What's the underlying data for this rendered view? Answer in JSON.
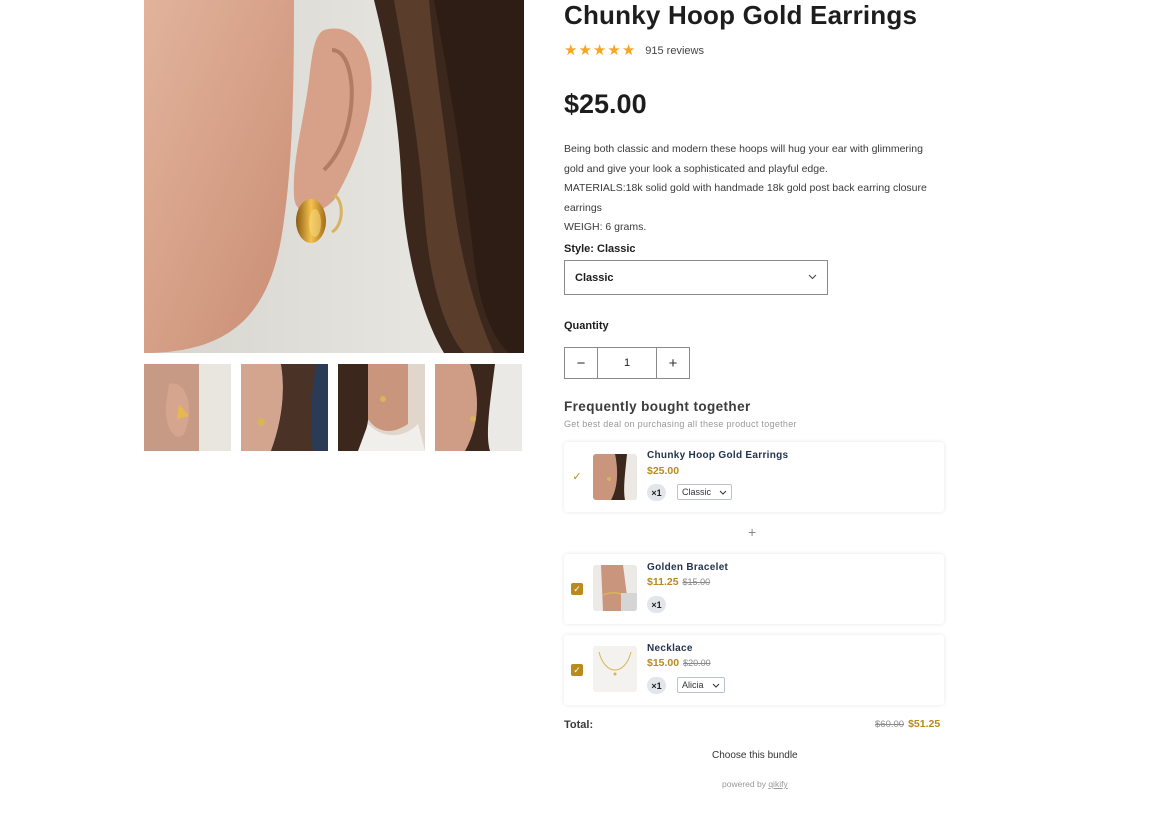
{
  "product": {
    "title": "Chunky Hoop Gold Earrings",
    "rating_stars": 5,
    "reviews": "915 reviews",
    "price": "$25.00",
    "description": [
      "Being both classic and modern these hoops will hug your ear with glimmering gold and give your look a sophisticated and playful edge.",
      "MATERIALS:18k solid gold with handmade 18k gold post back earring closure earrings",
      "WEIGH: 6 grams."
    ],
    "style_label": "Style: Classic",
    "style_value": "Classic",
    "quantity_label": "Quantity",
    "quantity": "1",
    "minus": "−",
    "plus": "+"
  },
  "bundle": {
    "title": "Frequently bought together",
    "subtitle": "Get best deal on purchasing all these product together",
    "separator": "+",
    "items": [
      {
        "name": "Chunky Hoop Gold Earrings",
        "price": "$25.00",
        "old_price": "",
        "qty": "×1",
        "variant": "Classic",
        "checked": true
      },
      {
        "name": "Golden Bracelet",
        "price": "$11.25",
        "old_price": "$15.00",
        "qty": "×1",
        "variant": "",
        "checked": true
      },
      {
        "name": "Necklace",
        "price": "$15.00",
        "old_price": "$20.00",
        "qty": "×1",
        "variant": "Alicia",
        "checked": true
      }
    ],
    "total_label": "Total:",
    "total_old": "$60.00",
    "total_new": "$51.25",
    "cta": "Choose this bundle",
    "powered_prefix": "powered by",
    "powered_brand": "qikify"
  },
  "colors": {
    "accent": "#b98a1c",
    "star": "#f5a623",
    "name": "#23344d"
  },
  "icons": {
    "star": "★",
    "chevron": "chevron-down-icon",
    "check": "check-icon"
  }
}
